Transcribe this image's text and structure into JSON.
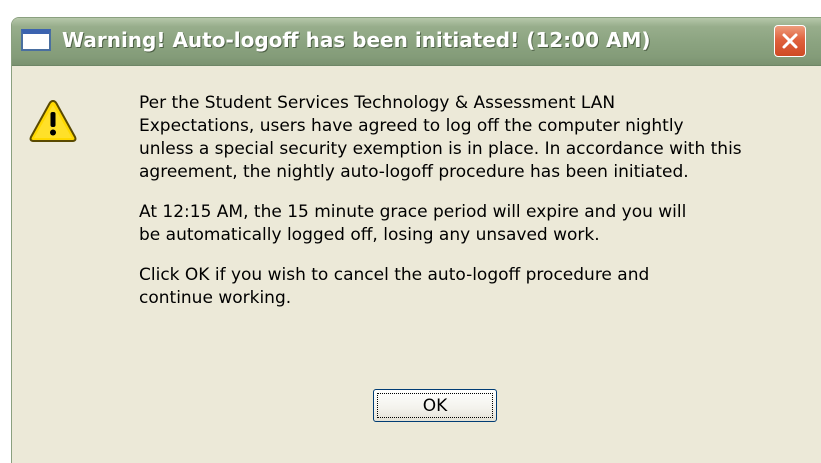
{
  "window": {
    "title": "Warning! Auto-logoff has been initiated! (12:00 AM)"
  },
  "titlebar_icons": {
    "app": "window-icon",
    "close": "close-icon"
  },
  "message_icon": "warning-icon",
  "message": {
    "paragraphs": [
      "Per the Student Services Technology & Assessment LAN\nExpectations, users have agreed to log off the computer nightly\nunless a special security exemption is in place. In accordance with this\nagreement, the nightly auto-logoff procedure has been initiated.",
      "At 12:15 AM, the 15 minute grace period will expire and you will\nbe automatically logged off, losing any unsaved work.",
      "Click OK if you wish to cancel the auto-logoff procedure and\ncontinue working."
    ]
  },
  "buttons": {
    "ok_label": "OK"
  },
  "colors": {
    "titlebar": "#8ca481",
    "dialog_bg": "#ece9d8",
    "close_button": "#e0623e",
    "warning_yellow": "#ffd800"
  }
}
